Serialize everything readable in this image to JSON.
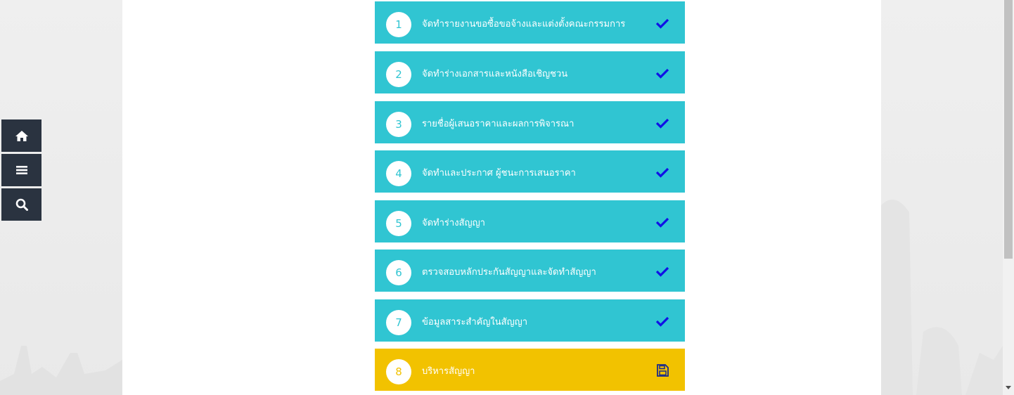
{
  "sidebar": {
    "buttons": [
      {
        "icon": "home-icon"
      },
      {
        "icon": "menu-icon"
      },
      {
        "icon": "search-icon"
      }
    ]
  },
  "steps": [
    {
      "number": "1",
      "label": "จัดทำรายงานขอซื้อขอจ้างและแต่งตั้งคณะกรรมการ",
      "status": "done",
      "icon": "check-icon"
    },
    {
      "number": "2",
      "label": "จัดทำร่างเอกสารและหนังสือเชิญชวน",
      "status": "done",
      "icon": "check-icon"
    },
    {
      "number": "3",
      "label": "รายชื่อผู้เสนอราคาและผลการพิจารณา",
      "status": "done",
      "icon": "check-icon"
    },
    {
      "number": "4",
      "label": "จัดทำและประกาศ ผู้ชนะการเสนอราคา",
      "status": "done",
      "icon": "check-icon"
    },
    {
      "number": "5",
      "label": "จัดทำร่างสัญญา",
      "status": "done",
      "icon": "check-icon"
    },
    {
      "number": "6",
      "label": "ตรวจสอบหลักประกันสัญญาและจัดทำสัญญา",
      "status": "done",
      "icon": "check-icon"
    },
    {
      "number": "7",
      "label": "ข้อมูลสาระสำคัญในสัญญา",
      "status": "done",
      "icon": "check-icon"
    },
    {
      "number": "8",
      "label": "บริหารสัญญา",
      "status": "current",
      "icon": "save-icon"
    }
  ],
  "colors": {
    "step_done_bg": "#30c5d2",
    "step_current_bg": "#f2c200",
    "check": "#1010e6",
    "sidebar_bg": "#2a3340"
  }
}
